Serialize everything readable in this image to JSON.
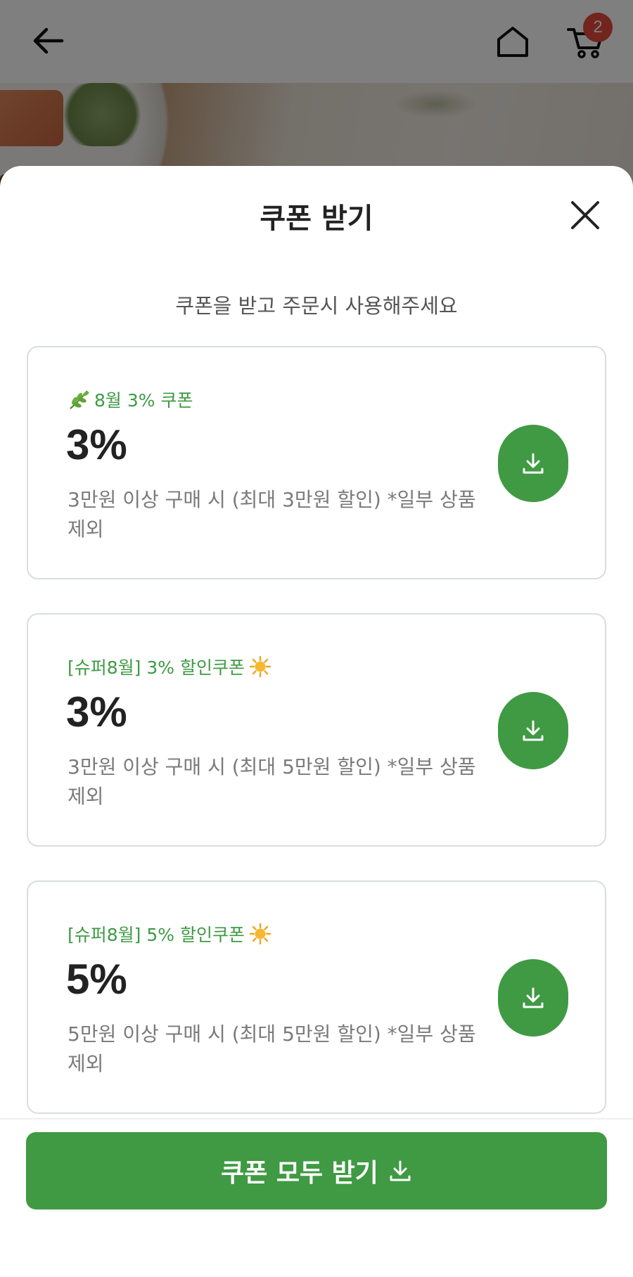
{
  "header": {
    "cart_count": "2",
    "back_icon": "arrow-left-icon",
    "home_icon": "home-icon",
    "cart_icon": "cart-icon"
  },
  "sheet": {
    "title": "쿠폰 받기",
    "subtitle": "쿠폰을 받고 주문시 사용해주세요",
    "close_icon": "close-icon"
  },
  "coupons": [
    {
      "name": "8월 3% 쿠폰",
      "name_icon": "herb-icon",
      "rate": "3%",
      "description": "3만원 이상 구매 시 (최대 3만원 할인) *일부 상품 제외"
    },
    {
      "name": "[슈퍼8월] 3% 할인쿠폰",
      "name_icon": "sun-icon",
      "rate": "3%",
      "description": "3만원 이상 구매 시 (최대 5만원 할인) *일부 상품 제외"
    },
    {
      "name": "[슈퍼8월] 5% 할인쿠폰",
      "name_icon": "sun-icon",
      "rate": "5%",
      "description": "5만원 이상 구매 시 (최대 5만원 할인) *일부 상품 제외"
    }
  ],
  "footer": {
    "download_all_label": "쿠폰 모두 받기"
  },
  "colors": {
    "accent": "#3f9a43",
    "badge": "#e5483d"
  }
}
